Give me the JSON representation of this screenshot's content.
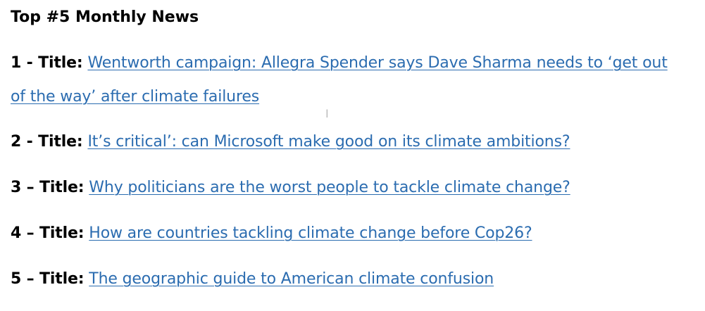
{
  "document": {
    "heading": "Top #5 Monthly News",
    "items": [
      {
        "prefix": "1 - Title:",
        "link_text": "Wentworth campaign: Allegra Spender says Dave Sharma needs to ‘get out of the way’ after climate failures"
      },
      {
        "prefix": "2 - Title:",
        "link_text": "It’s critical’: can Microsoft make good on its climate ambitions?"
      },
      {
        "prefix": "3 – Title:",
        "link_text": "Why politicians are the worst people to tackle climate change?"
      },
      {
        "prefix": "4 – Title:",
        "link_text": "How are countries tackling climate change before Cop26?"
      },
      {
        "prefix": "5 – Title:",
        "link_text": "The geographic guide to American climate confusion"
      }
    ],
    "link_color": "#2b6cb0",
    "cursor_icon": "text-cursor-icon"
  }
}
